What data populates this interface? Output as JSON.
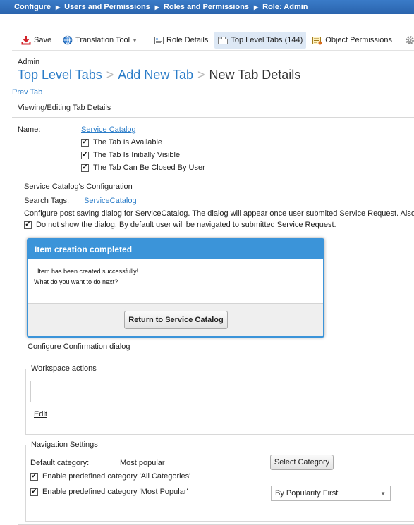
{
  "breadcrumb": [
    "Configure",
    "Users and Permissions",
    "Roles and Permissions",
    "Role: Admin"
  ],
  "toolbar": {
    "save": "Save",
    "translation_tool": "Translation Tool",
    "role_details": "Role Details",
    "top_level_tabs": "Top Level Tabs (144)",
    "object_permissions": "Object Permissions"
  },
  "header": {
    "admin": "Admin",
    "crumb1": "Top Level Tabs",
    "crumb2": "Add New Tab",
    "current": "New Tab Details",
    "prev_tab": "Prev Tab",
    "viewing": "Viewing/Editing Tab Details"
  },
  "tab": {
    "name_label": "Name:",
    "name_value": "Service Catalog",
    "available": "The Tab Is Available",
    "visible": "The Tab Is Initially Visible",
    "closable": "The Tab Can Be Closed By User"
  },
  "config": {
    "legend": "Service Catalog's Configuration",
    "search_tags_label": "Search Tags:",
    "search_tags_value": "ServiceCatalog",
    "info": "Configure post saving dialog for ServiceCatalog. The dialog will appear once user submited Service Request. Also",
    "dont_show": "Do not show the dialog. By default user will be navigated to submitted Service Request.",
    "configure_link": "Configure Confirmation dialog"
  },
  "dialog": {
    "title": "Item creation completed",
    "line1": "Item has been created successfully!",
    "line2": "What do you want to do next?",
    "button": "Return to Service Catalog"
  },
  "workspace": {
    "legend": "Workspace actions",
    "edit": "Edit"
  },
  "navigation": {
    "legend": "Navigation Settings",
    "default_category_label": "Default category:",
    "default_category_value": "Most popular",
    "select_category": "Select Category",
    "all_categories": "Enable predefined category 'All Categories'",
    "most_popular": "Enable predefined category 'Most Popular'",
    "sort_selected": "By Popularity First"
  },
  "colors": {
    "accent_blue": "#2a7cc8",
    "dialog_blue": "#3b94d9",
    "header_bar": "#2a64ad"
  }
}
